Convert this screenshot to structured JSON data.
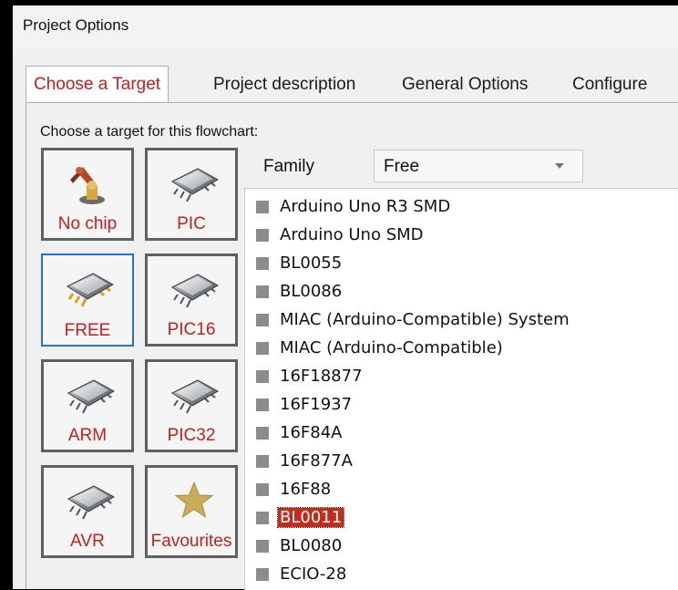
{
  "window": {
    "title": "Project Options"
  },
  "tabs": [
    {
      "label": "Choose a Target",
      "active": true
    },
    {
      "label": "Project description",
      "active": false
    },
    {
      "label": "General Options",
      "active": false
    },
    {
      "label": "Configure",
      "active": false
    }
  ],
  "target": {
    "prompt": "Choose a target for this flowchart:",
    "tiles": [
      {
        "label": "No chip",
        "icon": "robot-arm-icon"
      },
      {
        "label": "PIC",
        "icon": "chip-icon"
      },
      {
        "label": "FREE",
        "icon": "chip-gold-pins-icon",
        "selected": true
      },
      {
        "label": "PIC16",
        "icon": "chip-icon"
      },
      {
        "label": "ARM",
        "icon": "chip-icon"
      },
      {
        "label": "PIC32",
        "icon": "chip-icon"
      },
      {
        "label": "AVR",
        "icon": "chip-icon"
      },
      {
        "label": "Favourites",
        "icon": "star-icon"
      }
    ],
    "family": {
      "label": "Family",
      "value": "Free"
    },
    "devices": [
      "Arduino Uno R3 SMD",
      "Arduino Uno SMD",
      "BL0055",
      "BL0086",
      "MIAC (Arduino-Compatible) System",
      "MIAC (Arduino-Compatible)",
      "16F18877",
      "16F1937",
      "16F84A",
      "16F877A",
      "16F88",
      "BL0011",
      "BL0080",
      "ECIO-28"
    ],
    "selected_device": "BL0011"
  },
  "colors": {
    "accent_red": "#c0201f",
    "selection_blue": "#2a6fd6",
    "list_selection": "#c42b1c"
  }
}
